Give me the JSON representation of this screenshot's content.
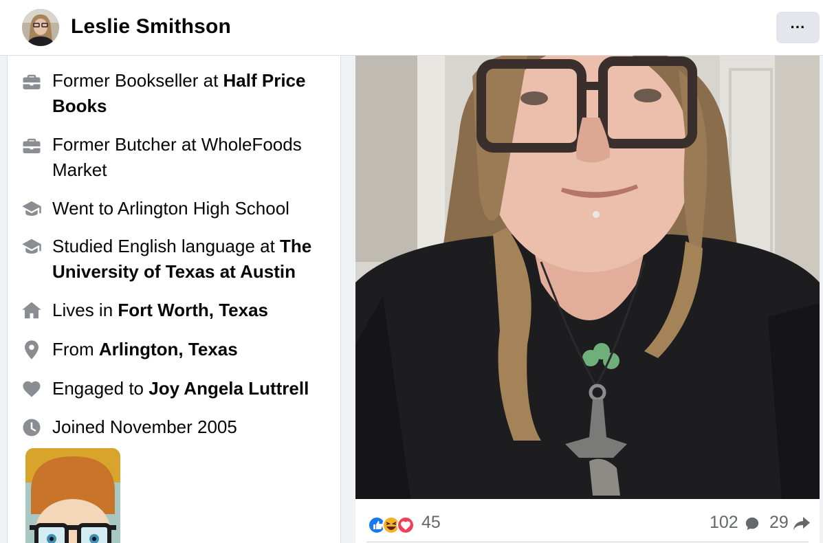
{
  "header": {
    "name": "Leslie Smithson",
    "more_label": "···"
  },
  "intro": {
    "items": [
      {
        "icon": "briefcase-icon",
        "prefix": "Former Bookseller at ",
        "bold": "Half Price Books"
      },
      {
        "icon": "briefcase-icon",
        "prefix": "Former Butcher at WholeFoods Market",
        "bold": ""
      },
      {
        "icon": "graduation-cap-icon",
        "prefix": "Went to Arlington High School",
        "bold": ""
      },
      {
        "icon": "graduation-cap-icon",
        "prefix": "Studied English language at ",
        "bold": "The University of Texas at Austin"
      },
      {
        "icon": "home-icon",
        "prefix": "Lives in ",
        "bold": "Fort Worth, Texas"
      },
      {
        "icon": "location-pin-icon",
        "prefix": "From ",
        "bold": "Arlington, Texas"
      },
      {
        "icon": "heart-icon",
        "prefix": "Engaged to ",
        "bold": "Joy Angela Luttrell"
      },
      {
        "icon": "clock-icon",
        "prefix": "Joined November 2005",
        "bold": ""
      }
    ]
  },
  "post": {
    "reaction_icons": [
      "like-icon",
      "haha-icon",
      "love-icon"
    ],
    "reaction_count": "45",
    "comment_count": "102",
    "share_count": "29"
  },
  "colors": {
    "icon_gray": "#8a8d91",
    "secondary_text": "#65676b",
    "like_blue": "#1877f2",
    "love_red": "#f33e58",
    "haha_yellow": "#f7b125"
  }
}
